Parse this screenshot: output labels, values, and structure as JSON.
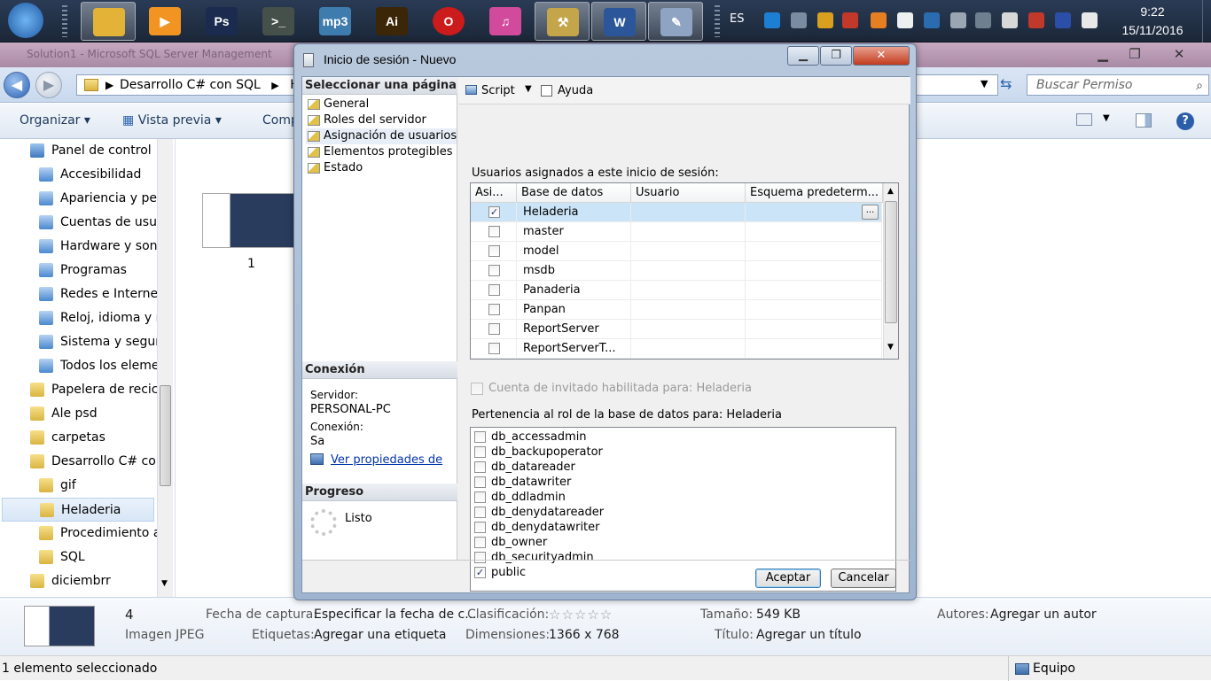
{
  "taskbar": {
    "apps": [
      {
        "name": "start-button",
        "label": ""
      },
      {
        "name": "explorer",
        "label": ""
      },
      {
        "name": "media-player",
        "label": "▶"
      },
      {
        "name": "photoshop",
        "label": "Ps"
      },
      {
        "name": "terminal",
        "label": ">_"
      },
      {
        "name": "mp3",
        "label": "mp3"
      },
      {
        "name": "illustrator",
        "label": "Ai"
      },
      {
        "name": "opera",
        "label": "O"
      },
      {
        "name": "itunes",
        "label": "♫"
      },
      {
        "name": "sql-config",
        "label": "⚒"
      },
      {
        "name": "word",
        "label": "W"
      },
      {
        "name": "paint",
        "label": "✎"
      }
    ],
    "language": "ES",
    "time": "9:22",
    "date": "15/11/2016"
  },
  "explorer": {
    "window_title": "Solution1 - Microsoft SQL Server Management",
    "address_segments": [
      "Desarrollo C# con SQL",
      "He"
    ],
    "search_placeholder": "Buscar Permiso",
    "commands": {
      "organize": "Organizar",
      "preview": "Vista previa",
      "share": "Comp"
    },
    "tree": [
      {
        "label": "Panel de control",
        "indent": 1
      },
      {
        "label": "Accesibilidad",
        "indent": 2
      },
      {
        "label": "Apariencia y per",
        "indent": 2
      },
      {
        "label": "Cuentas de usua",
        "indent": 2
      },
      {
        "label": "Hardware y soni",
        "indent": 2
      },
      {
        "label": "Programas",
        "indent": 2
      },
      {
        "label": "Redes e Internet",
        "indent": 2
      },
      {
        "label": "Reloj, idioma y r",
        "indent": 2
      },
      {
        "label": "Sistema y seguri",
        "indent": 2
      },
      {
        "label": "Todos los eleme",
        "indent": 2
      },
      {
        "label": "Papelera de recicl",
        "indent": 1
      },
      {
        "label": "Ale psd",
        "indent": 1
      },
      {
        "label": "carpetas",
        "indent": 1
      },
      {
        "label": "Desarrollo C# cor",
        "indent": 1
      },
      {
        "label": "gif",
        "indent": 2
      },
      {
        "label": "Heladeria",
        "indent": 2,
        "selected": true
      },
      {
        "label": "Procedimiento a",
        "indent": 2
      },
      {
        "label": "SQL",
        "indent": 2
      },
      {
        "label": "diciembrr",
        "indent": 1
      }
    ],
    "thumbnail_caption": "1",
    "details": {
      "count": "4",
      "type": "Imagen JPEG",
      "capture_date_label": "Fecha de captura:",
      "capture_date_value": "Especificar la fecha de c...",
      "tags_label": "Etiquetas:",
      "tags_value": "Agregar una etiqueta",
      "rating_label": "Clasificación:",
      "rating_stars": "☆☆☆☆☆",
      "dimensions_label": "Dimensiones:",
      "dimensions_value": "1366 x 768",
      "size_label": "Tamaño:",
      "size_value": "549 KB",
      "title_label": "Título:",
      "title_value": "Agregar un título",
      "authors_label": "Autores:",
      "authors_value": "Agregar un autor"
    },
    "status_left": "1 elemento seleccionado",
    "status_right": "Equipo"
  },
  "dialog": {
    "title": "Inicio de sesión - Nuevo",
    "select_page_header": "Seleccionar una página",
    "pages": [
      "General",
      "Roles del servidor",
      "Asignación de usuarios",
      "Elementos protegibles",
      "Estado"
    ],
    "selected_page": 2,
    "connection_header": "Conexión",
    "server_label": "Servidor:",
    "server_value": "PERSONAL-PC",
    "connection_label": "Conexión:",
    "connection_value": "Sa",
    "view_properties_link": "Ver propiedades de",
    "progress_header": "Progreso",
    "progress_status": "Listo",
    "toolbar": {
      "script": "Script",
      "help": "Ayuda"
    },
    "users_label": "Usuarios asignados a este inicio de sesión:",
    "grid_columns": [
      "Asi...",
      "Base de datos",
      "Usuario",
      "Esquema predeterm..."
    ],
    "grid_rows": [
      {
        "checked": true,
        "db": "Heladeria",
        "user": "",
        "schema": "",
        "selected": true
      },
      {
        "checked": false,
        "db": "master",
        "user": "",
        "schema": ""
      },
      {
        "checked": false,
        "db": "model",
        "user": "",
        "schema": ""
      },
      {
        "checked": false,
        "db": "msdb",
        "user": "",
        "schema": ""
      },
      {
        "checked": false,
        "db": "Panaderia",
        "user": "",
        "schema": ""
      },
      {
        "checked": false,
        "db": "Panpan",
        "user": "",
        "schema": ""
      },
      {
        "checked": false,
        "db": "ReportServer",
        "user": "",
        "schema": ""
      },
      {
        "checked": false,
        "db": "ReportServerT...",
        "user": "",
        "schema": ""
      }
    ],
    "ellipsis": "...",
    "guest_label": "Cuenta de invitado habilitada para: Heladeria",
    "membership_label": "Pertenencia al rol de la base de datos para: Heladeria",
    "roles": [
      {
        "label": "db_accessadmin",
        "checked": false
      },
      {
        "label": "db_backupoperator",
        "checked": false
      },
      {
        "label": "db_datareader",
        "checked": false
      },
      {
        "label": "db_datawriter",
        "checked": false
      },
      {
        "label": "db_ddladmin",
        "checked": false
      },
      {
        "label": "db_denydatareader",
        "checked": false
      },
      {
        "label": "db_denydatawriter",
        "checked": false
      },
      {
        "label": "db_owner",
        "checked": false
      },
      {
        "label": "db_securityadmin",
        "checked": false
      },
      {
        "label": "public",
        "checked": true
      }
    ],
    "ok_label": "Aceptar",
    "cancel_label": "Cancelar"
  },
  "colors": {
    "accent": "#1e395b",
    "selection": "#cce4f7",
    "link": "#0033aa"
  }
}
